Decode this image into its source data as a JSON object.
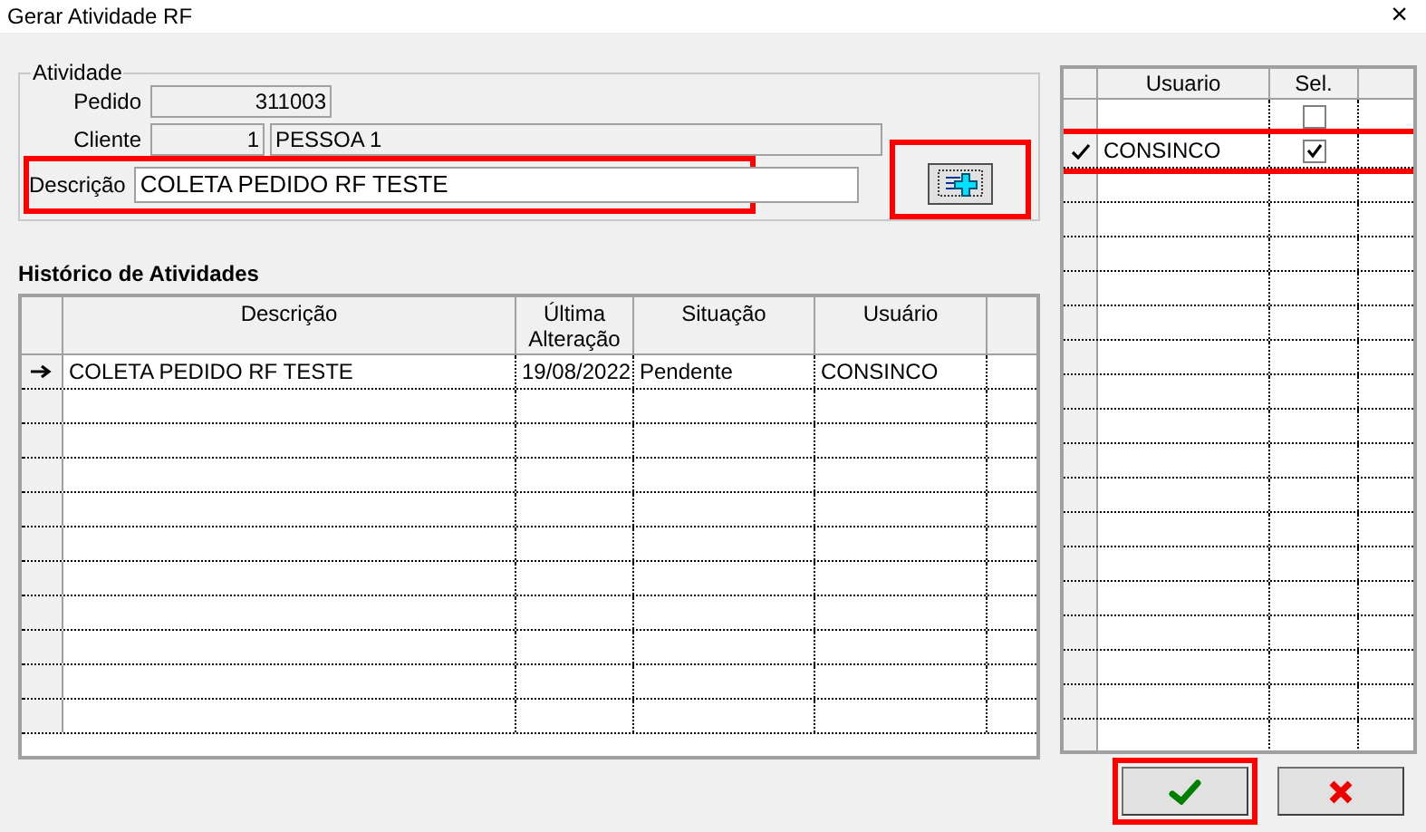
{
  "window": {
    "title": "Gerar Atividade RF",
    "close": "×"
  },
  "atividade": {
    "legend": "Atividade",
    "pedido": {
      "label": "Pedido",
      "value": "311003"
    },
    "cliente": {
      "label": "Cliente",
      "code": "1",
      "name": "PESSOA 1"
    },
    "descricao": {
      "label": "Descrição",
      "value": "COLETA PEDIDO RF TESTE",
      "highlighted": true
    },
    "add_button": {
      "highlighted": true
    }
  },
  "historico": {
    "title": "Histórico de Atividades",
    "columns": [
      "Descrição",
      "Última Alteração",
      "Situação",
      "Usuário"
    ],
    "rows": [
      {
        "cells": [
          "COLETA PEDIDO RF TESTE",
          "19/08/2022",
          "Pendente",
          "CONSINCO"
        ],
        "current": true
      }
    ]
  },
  "usuarios": {
    "columns": [
      "Usuario",
      "Sel."
    ],
    "rows": [
      {
        "checked": false,
        "current": false,
        "highlighted": false
      },
      {
        "name": "CONSINCO",
        "checked": true,
        "current": true,
        "highlighted": true
      }
    ]
  },
  "buttons": [
    {
      "kind": "ok",
      "highlighted": true
    },
    {
      "kind": "cancel",
      "highlighted": false
    }
  ]
}
